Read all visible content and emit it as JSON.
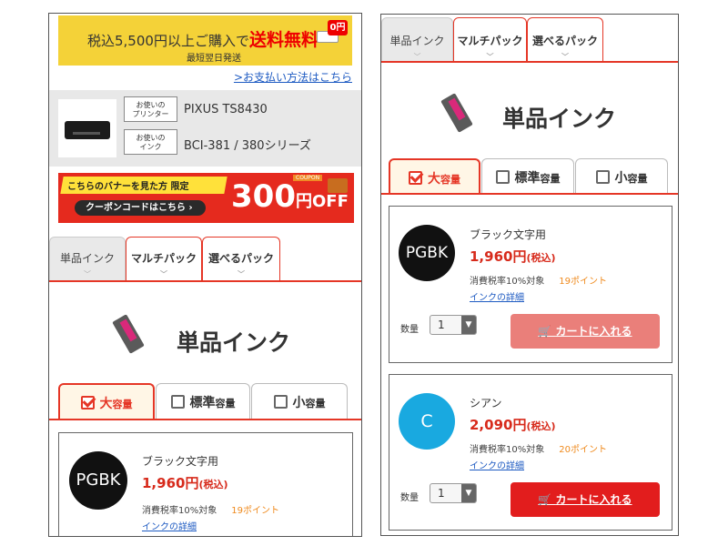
{
  "left": {
    "shipping": {
      "prefix": "税込5,500円以上ご購入で",
      "highlight": "送料無料",
      "badge": "0円",
      "sub": "最短翌日発送"
    },
    "payment_link": ">お支払い方法はこちら",
    "printer": {
      "printer_label": "お使いの\nプリンター",
      "printer_value": "PIXUS TS8430",
      "ink_label": "お使いの\nインク",
      "ink_value": "BCI-381 / 380シリーズ"
    },
    "coupon": {
      "headline": "こちらのバナーを見た方 限定",
      "button": "クーポンコードはこちら ›",
      "amount": "300",
      "unit": "円OFF",
      "tag": "COUPON"
    },
    "tabs": [
      "単品インク",
      "マルチパック",
      "選べるパック"
    ],
    "section_title": "単品インク",
    "cap_tabs": [
      {
        "main": "大",
        "small": "容量"
      },
      {
        "main": "標準",
        "small": "容量"
      },
      {
        "main": "小",
        "small": "容量"
      }
    ],
    "product": {
      "code": "PGBK",
      "name": "ブラック文字用",
      "price": "1,960円",
      "tax_in": "(税込)",
      "tax_note": "消費税率10%対象",
      "points": "19ポイント",
      "detail": "インクの詳細"
    }
  },
  "right": {
    "tabs": [
      "単品インク",
      "マルチパック",
      "選べるパック"
    ],
    "section_title": "単品インク",
    "cap_tabs": [
      {
        "main": "大",
        "small": "容量"
      },
      {
        "main": "標準",
        "small": "容量"
      },
      {
        "main": "小",
        "small": "容量"
      }
    ],
    "products": [
      {
        "code": "PGBK",
        "name": "ブラック文字用",
        "price": "1,960円",
        "tax_in": "(税込)",
        "tax_note": "消費税率10%対象",
        "points": "19ポイント",
        "detail": "インクの詳細",
        "qty_label": "数量",
        "qty": "1",
        "button": "カートに入れる",
        "color": "#111111"
      },
      {
        "code": "C",
        "name": "シアン",
        "price": "2,090円",
        "tax_in": "(税込)",
        "tax_note": "消費税率10%対象",
        "points": "20ポイント",
        "detail": "インクの詳細",
        "qty_label": "数量",
        "qty": "1",
        "button": "カートに入れる",
        "color": "#19a9e0"
      }
    ]
  },
  "colors": {
    "accent": "#e53626",
    "price": "#d72a1b",
    "link": "#1d5ac2",
    "points": "#ef8a1d",
    "banner_yellow": "#f4d238"
  }
}
